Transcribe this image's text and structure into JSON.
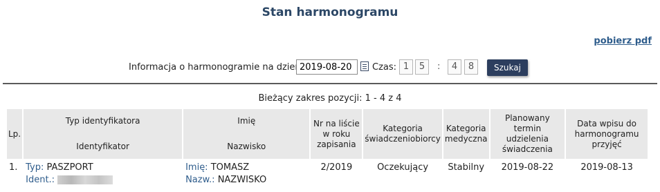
{
  "page": {
    "title": "Stan harmonogramu",
    "pdf_link": "pobierz pdf"
  },
  "search": {
    "label": "Informacja o harmonogramie na dzień:",
    "date": "2019-08-20",
    "time_label": "Czas:",
    "hour_digits": [
      "1",
      "5"
    ],
    "colon": ":",
    "minute_digits": [
      "4",
      "8"
    ],
    "button": "Szukaj"
  },
  "range_text": "Bieżący zakres pozycji: 1 - 4 z 4",
  "table": {
    "headers": {
      "lp": "Lp.",
      "typ": "Typ identyfikatora",
      "ident": "Identyfikator",
      "imie": "Imię",
      "nazwisko": "Nazwisko",
      "nr": "Nr na liście w roku zapisania",
      "kat_sw": "Kategoria świadczeniobiorcy",
      "kat_med": "Kategoria medyczna",
      "termin": "Planowany termin udzielenia świadczenia",
      "data_wpisu": "Data wpisu do harmonogramu przyjęć"
    },
    "rows": [
      {
        "lp": "1.",
        "typ_label": "Typ:",
        "typ_value": "PASZPORT",
        "ident_label": "Ident.:",
        "imie_label": "Imię:",
        "imie_value": "TOMASZ",
        "nazw_label": "Nazw.:",
        "nazw_value": "NAZWISKO",
        "nr": "2/2019",
        "kat_sw": "Oczekujący",
        "kat_med": "Stabilny",
        "termin": "2019-08-22",
        "data_wpisu": "2019-08-13"
      }
    ]
  },
  "colors": {
    "title": "#2c4766",
    "link": "#2f5d8c",
    "button_bg": "#2c3e5e",
    "header_bg": "#e8e8e8"
  },
  "icons": {
    "calendar": "calendar-icon"
  }
}
